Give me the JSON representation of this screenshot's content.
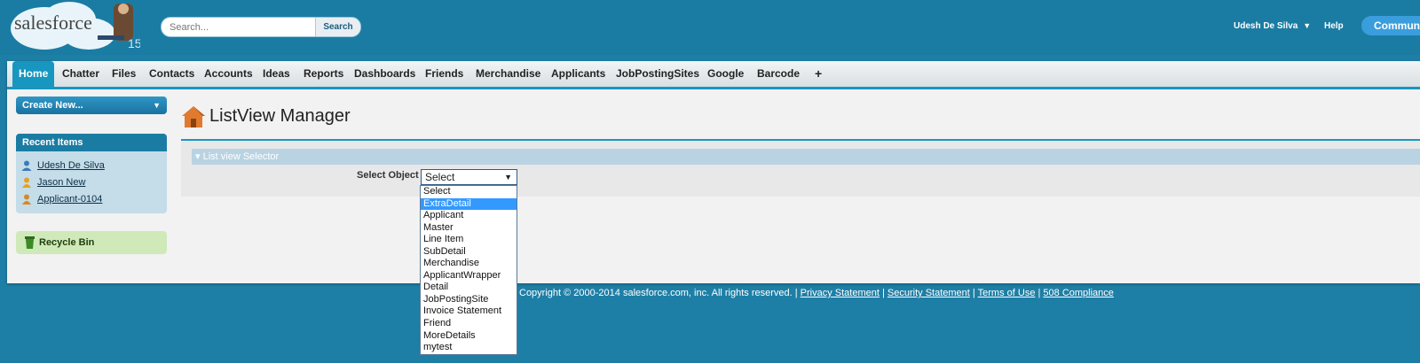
{
  "header": {
    "logo_text": "salesforce",
    "logo_version": "15",
    "search_placeholder": "Search...",
    "search_button": "Search",
    "user_name": "Udesh De Silva",
    "help_label": "Help",
    "community_label": "Communi"
  },
  "tabs": [
    {
      "label": "Home",
      "active": true
    },
    {
      "label": "Chatter"
    },
    {
      "label": "Files"
    },
    {
      "label": "Contacts"
    },
    {
      "label": "Accounts"
    },
    {
      "label": "Ideas"
    },
    {
      "label": "Reports"
    },
    {
      "label": "Dashboards"
    },
    {
      "label": "Friends"
    },
    {
      "label": "Merchandise"
    },
    {
      "label": "Applicants"
    },
    {
      "label": "JobPostingSites"
    },
    {
      "label": "Google"
    },
    {
      "label": "Barcode"
    },
    {
      "label": "+"
    }
  ],
  "sidebar": {
    "create_new": "Create New...",
    "recent_title": "Recent Items",
    "recent_items": [
      {
        "label": "Udesh De Silva",
        "icon": "user-icon"
      },
      {
        "label": "Jason New",
        "icon": "person-icon"
      },
      {
        "label": "Applicant-0104",
        "icon": "applicant-icon"
      }
    ],
    "recycle_bin": "Recycle Bin"
  },
  "main": {
    "title": "ListView Manager",
    "section_title": "List view Selector",
    "field_label": "Select Object",
    "select_value": "Select",
    "options": [
      "Select",
      "ExtraDetail",
      "Applicant",
      "Master",
      "Line Item",
      "SubDetail",
      "Merchandise",
      "ApplicantWrapper",
      "Detail",
      "JobPostingSite",
      "Invoice Statement",
      "Friend",
      "MoreDetails",
      "mytest"
    ],
    "highlighted_option": "ExtraDetail"
  },
  "footer": {
    "copyright": "Copyright © 2000-2014 salesforce.com, inc. All rights reserved. | ",
    "links": [
      "Privacy Statement",
      "Security Statement",
      "Terms of Use",
      "508 Compliance"
    ],
    "separator": " | "
  },
  "colors": {
    "background": "#1e7fa6",
    "tab_active": "#1797c0",
    "highlight": "#3399ff"
  }
}
